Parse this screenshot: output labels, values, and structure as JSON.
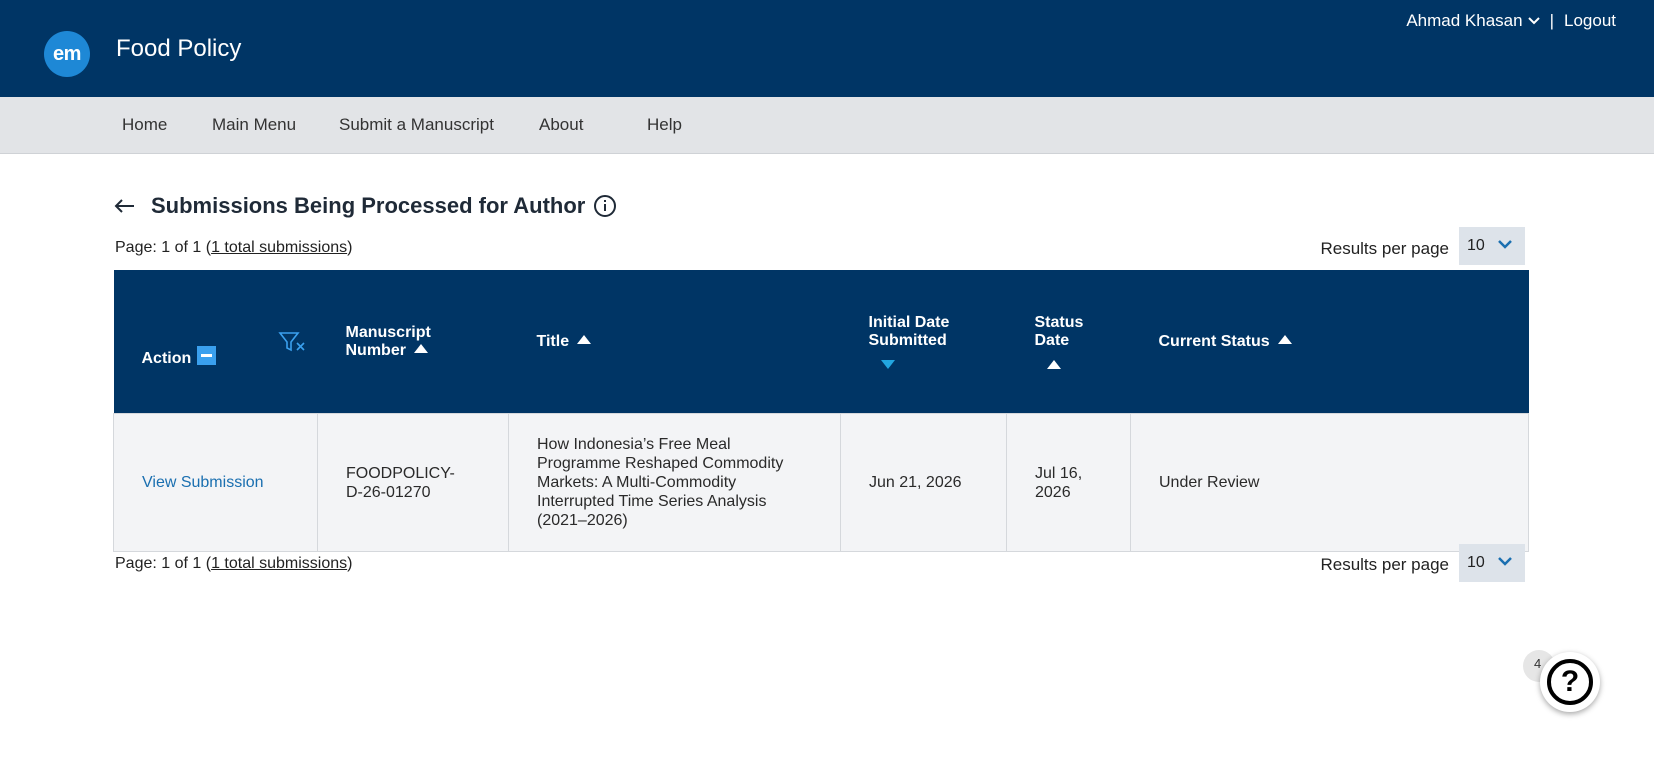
{
  "header": {
    "logo_text": "em",
    "journal_title": "Food Policy",
    "user_name": "Ahmad Khasan",
    "separator": "|",
    "logout_label": "Logout"
  },
  "nav": {
    "items": [
      {
        "label": "Home"
      },
      {
        "label": "Main Menu"
      },
      {
        "label": "Submit a Manuscript"
      },
      {
        "label": "About"
      },
      {
        "label": "Help"
      }
    ]
  },
  "page": {
    "title": "Submissions Being Processed for Author",
    "pager_prefix": "Page: 1 of 1 (",
    "pager_link": "1 total submissions",
    "pager_suffix": ")",
    "results_per_page_label": "Results per page",
    "results_per_page_value": "10"
  },
  "table": {
    "headers": {
      "action": "Action",
      "manuscript_number": [
        "Manuscript",
        "Number"
      ],
      "title": "Title",
      "initial_date": [
        "Initial Date",
        "Submitted"
      ],
      "status_date": [
        "Status",
        "Date"
      ],
      "current_status": "Current Status"
    },
    "rows": [
      {
        "action": "View Submission",
        "manuscript_number": [
          "FOODPOLICY-",
          "D-26-01270"
        ],
        "title": [
          "How Indonesia’s Free Meal",
          "Programme Reshaped Commodity",
          "Markets: A Multi-Commodity",
          "Interrupted Time Series Analysis",
          "(2021–2026)"
        ],
        "initial_date": "Jun 21, 2026",
        "status_date": [
          "Jul 16,",
          "2026"
        ],
        "current_status": "Under Review"
      }
    ]
  },
  "help_widget": {
    "badge_count": "4",
    "symbol": "?"
  },
  "colors": {
    "header_bg": "#003565",
    "nav_bg": "#e2e4e7",
    "link": "#1a6fb0",
    "sort_active": "#22a6e0"
  }
}
